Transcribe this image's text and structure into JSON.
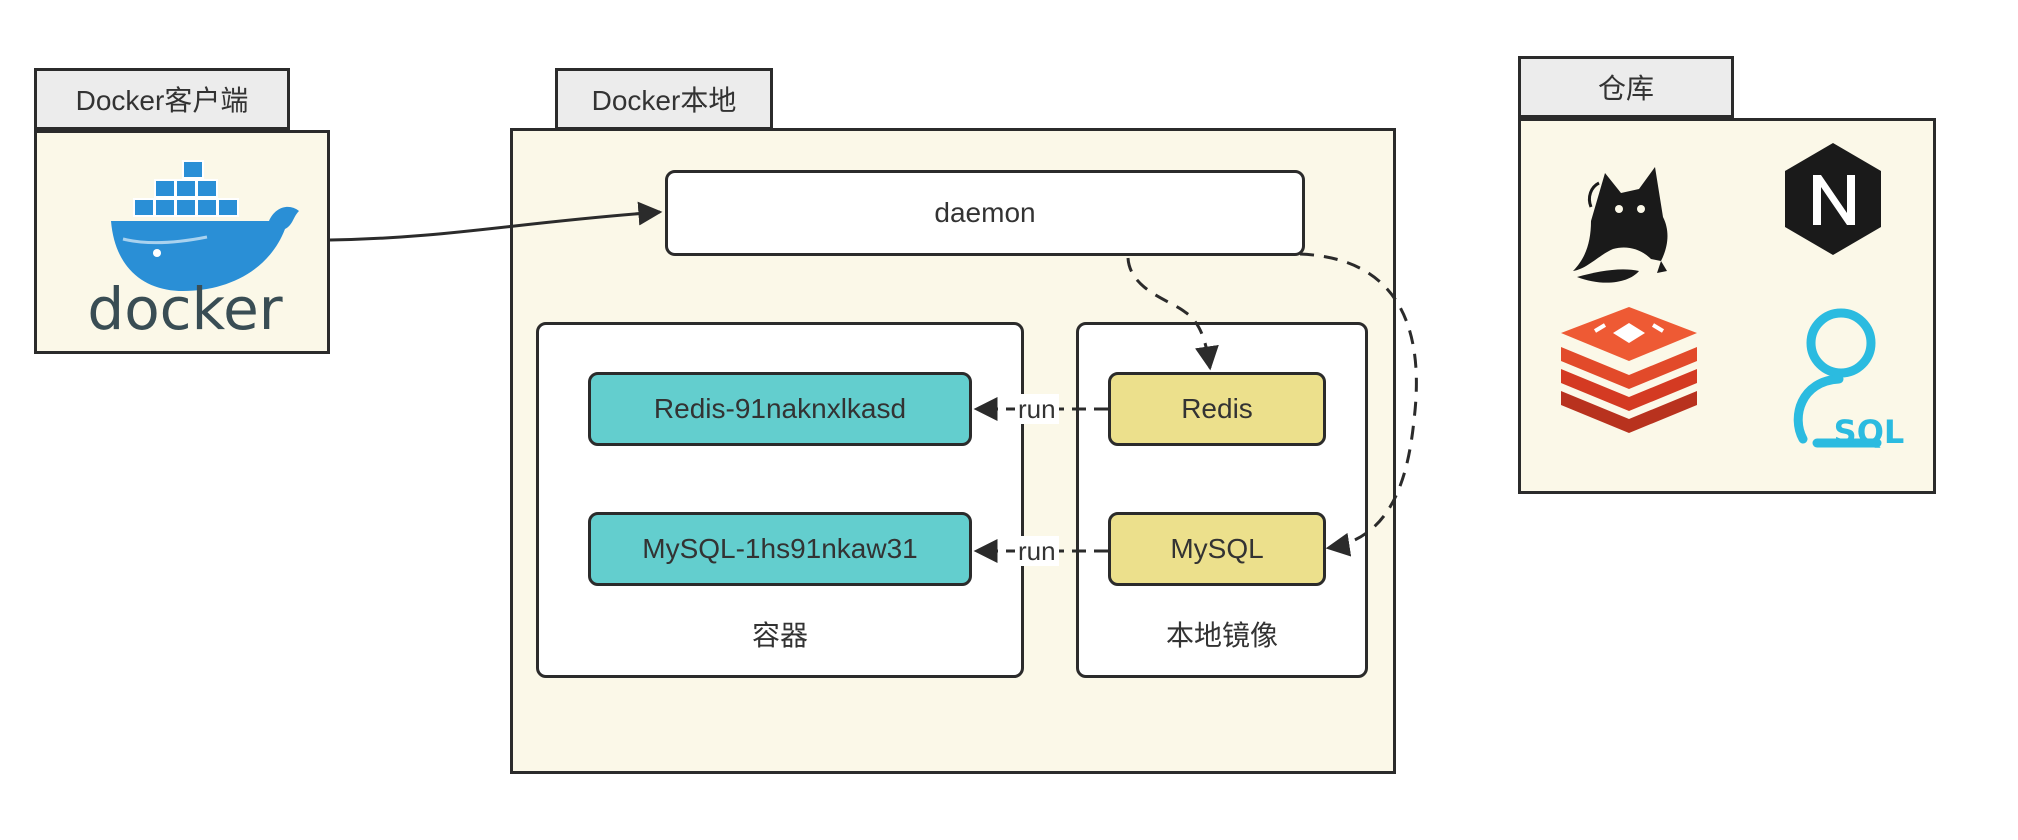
{
  "client": {
    "tab_label": "Docker客户端",
    "logo_text": "docker"
  },
  "local": {
    "tab_label": "Docker本地",
    "daemon_label": "daemon",
    "containers": {
      "caption": "容器",
      "items": [
        {
          "label": "Redis-91naknxlkasd"
        },
        {
          "label": "MySQL-1hs91nkaw31"
        }
      ]
    },
    "images": {
      "caption": "本地镜像",
      "items": [
        {
          "label": "Redis"
        },
        {
          "label": "MySQL"
        }
      ]
    },
    "run_label": "run"
  },
  "registry": {
    "tab_label": "仓库",
    "icons": [
      "tomcat-icon",
      "nginx-icon",
      "redis-icon",
      "sql-icon"
    ],
    "sql_icon_text": "SQL"
  },
  "colors": {
    "panel_fill": "#fbf8e8",
    "container_fill": "#63cece",
    "image_fill": "#ece08c",
    "docker_blue": "#2a8fd6",
    "redis_red": "#e84c2c",
    "sql_cyan": "#2bbbe0"
  }
}
